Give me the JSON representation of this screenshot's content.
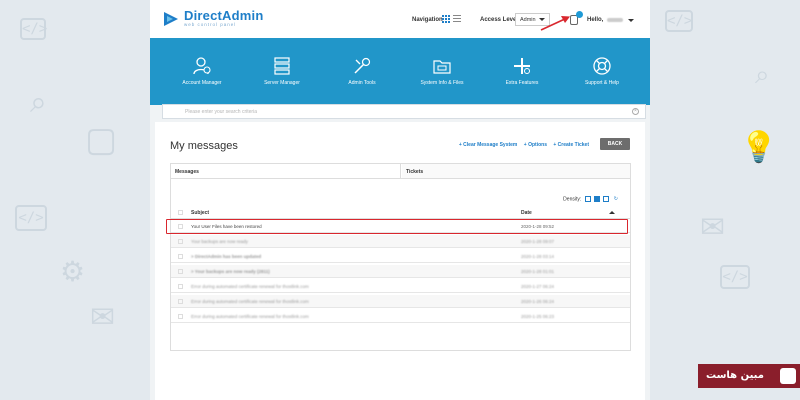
{
  "app": {
    "brand": "DirectAdmin",
    "brand_tagline": "web control panel"
  },
  "topbar": {
    "navigation_label": "Navigation",
    "access_level_label": "Access Level",
    "access_level_value": "Admin",
    "greeting": "Hello,"
  },
  "menu": [
    {
      "label": "Account Manager",
      "icon": "user-gear-icon"
    },
    {
      "label": "Server Manager",
      "icon": "server-icon"
    },
    {
      "label": "Admin Tools",
      "icon": "tools-icon"
    },
    {
      "label": "System Info & Files",
      "icon": "folder-icon"
    },
    {
      "label": "Extra Features",
      "icon": "plus-puzzle-icon"
    },
    {
      "label": "Support & Help",
      "icon": "lifebuoy-icon"
    }
  ],
  "search": {
    "placeholder": "Please enter your search criteria"
  },
  "page": {
    "title": "My messages",
    "links": [
      "+ Clear Message System",
      "+ Options",
      "+ Create Ticket"
    ],
    "back_label": "BACK",
    "tabs": [
      "Messages",
      "Tickets"
    ],
    "density_label": "Density:",
    "columns": {
      "subject": "Subject",
      "date": "Date"
    }
  },
  "messages": [
    {
      "subject": "Your User Files have been restored",
      "date": "2020-1-28 09:52",
      "blurred": false,
      "bold": false
    },
    {
      "subject": "Your backups are now ready",
      "date": "2020-1-28 09:07",
      "blurred": true,
      "bold": false
    },
    {
      "subject": "> DirectAdmin has been updated",
      "date": "2020-1-28 03:14",
      "blurred": true,
      "bold": true
    },
    {
      "subject": "> Your backups are now ready (2811)",
      "date": "2020-1-28 01:01",
      "blurred": true,
      "bold": true
    },
    {
      "subject": "Error during automated certificate renewal for thostlink.com",
      "date": "2020-1-27 06:24",
      "blurred": true,
      "bold": false
    },
    {
      "subject": "Error during automated certificate renewal for thostlink.com",
      "date": "2020-1-26 06:24",
      "blurred": true,
      "bold": false
    },
    {
      "subject": "Error during automated certificate renewal for thostlink.com",
      "date": "2020-1-25 06:23",
      "blurred": true,
      "bold": false
    }
  ],
  "watermark": {
    "text": "مبین هاست"
  },
  "colors": {
    "accent": "#2196c9",
    "highlight": "#d9272e",
    "brand_badge": "#8a1e2b"
  }
}
